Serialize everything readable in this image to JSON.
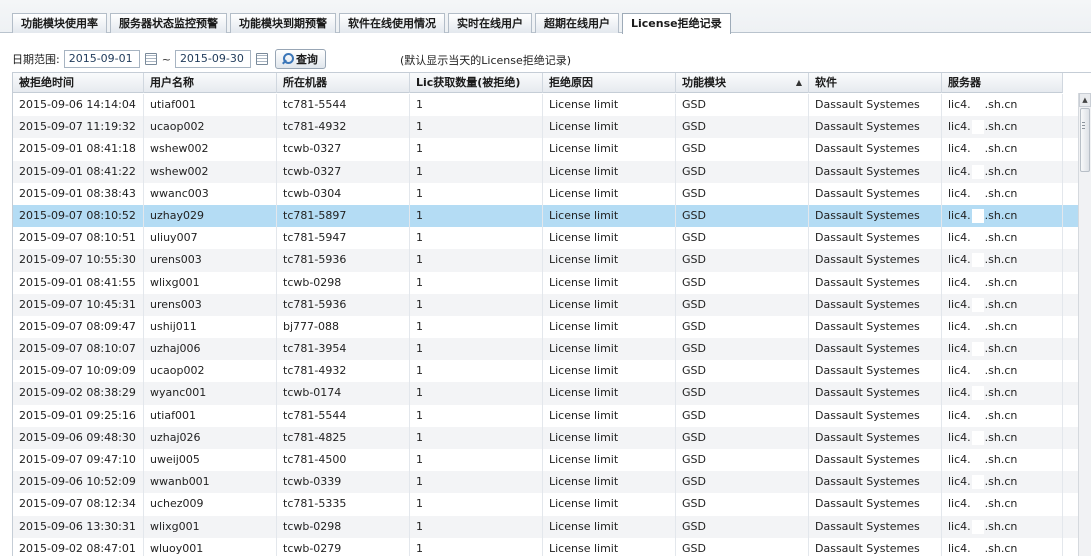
{
  "tabs": [
    {
      "label": "功能模块使用率"
    },
    {
      "label": "服务器状态监控预警"
    },
    {
      "label": "功能模块到期预警"
    },
    {
      "label": "软件在线使用情况"
    },
    {
      "label": "实时在线用户"
    },
    {
      "label": "超期在线用户"
    },
    {
      "label": "License拒绝记录",
      "active": true
    }
  ],
  "filter": {
    "date_label": "日期范围:",
    "start_date": "2015-09-01",
    "separator": "~",
    "end_date": "2015-09-30",
    "query_label": "查询",
    "note": "(默认显示当天的License拒绝记录)"
  },
  "table": {
    "columns": [
      "被拒绝时间",
      "用户名称",
      "所在机器",
      "Lic获取数量(被拒绝)",
      "拒绝原因",
      "功能模块",
      "软件",
      "服务器"
    ],
    "sorted_column": 5,
    "sort_direction": "asc",
    "selected_row": 5,
    "rows": [
      [
        "2015-09-06 14:14:04",
        "utiaf001",
        "tc781-5544",
        "1",
        "License limit",
        "GSD",
        "Dassault Systemes",
        [
          "lic4.",
          ".sh.cn"
        ]
      ],
      [
        "2015-09-07 11:19:32",
        "ucaop002",
        "tc781-4932",
        "1",
        "License limit",
        "GSD",
        "Dassault Systemes",
        [
          "lic4.",
          ".sh.cn"
        ]
      ],
      [
        "2015-09-01 08:41:18",
        "wshew002",
        "tcwb-0327",
        "1",
        "License limit",
        "GSD",
        "Dassault Systemes",
        [
          "lic4.",
          ".sh.cn"
        ]
      ],
      [
        "2015-09-01 08:41:22",
        "wshew002",
        "tcwb-0327",
        "1",
        "License limit",
        "GSD",
        "Dassault Systemes",
        [
          "lic4.",
          ".sh.cn"
        ]
      ],
      [
        "2015-09-01 08:38:43",
        "wwanc003",
        "tcwb-0304",
        "1",
        "License limit",
        "GSD",
        "Dassault Systemes",
        [
          "lic4.",
          ".sh.cn"
        ]
      ],
      [
        "2015-09-07 08:10:52",
        "uzhay029",
        "tc781-5897",
        "1",
        "License limit",
        "GSD",
        "Dassault Systemes",
        [
          "lic4.",
          ".sh.cn"
        ]
      ],
      [
        "2015-09-07 08:10:51",
        "uliuy007",
        "tc781-5947",
        "1",
        "License limit",
        "GSD",
        "Dassault Systemes",
        [
          "lic4.",
          ".sh.cn"
        ]
      ],
      [
        "2015-09-07 10:55:30",
        "urens003",
        "tc781-5936",
        "1",
        "License limit",
        "GSD",
        "Dassault Systemes",
        [
          "lic4.",
          ".sh.cn"
        ]
      ],
      [
        "2015-09-01 08:41:55",
        "wlixg001",
        "tcwb-0298",
        "1",
        "License limit",
        "GSD",
        "Dassault Systemes",
        [
          "lic4.",
          ".sh.cn"
        ]
      ],
      [
        "2015-09-07 10:45:31",
        "urens003",
        "tc781-5936",
        "1",
        "License limit",
        "GSD",
        "Dassault Systemes",
        [
          "lic4.",
          ".sh.cn"
        ]
      ],
      [
        "2015-09-07 08:09:47",
        "ushij011",
        "bj777-088",
        "1",
        "License limit",
        "GSD",
        "Dassault Systemes",
        [
          "lic4.",
          ".sh.cn"
        ]
      ],
      [
        "2015-09-07 08:10:07",
        "uzhaj006",
        "tc781-3954",
        "1",
        "License limit",
        "GSD",
        "Dassault Systemes",
        [
          "lic4.",
          ".sh.cn"
        ]
      ],
      [
        "2015-09-07 10:09:09",
        "ucaop002",
        "tc781-4932",
        "1",
        "License limit",
        "GSD",
        "Dassault Systemes",
        [
          "lic4.",
          ".sh.cn"
        ]
      ],
      [
        "2015-09-02 08:38:29",
        "wyanc001",
        "tcwb-0174",
        "1",
        "License limit",
        "GSD",
        "Dassault Systemes",
        [
          "lic4.",
          ".sh.cn"
        ]
      ],
      [
        "2015-09-01 09:25:16",
        "utiaf001",
        "tc781-5544",
        "1",
        "License limit",
        "GSD",
        "Dassault Systemes",
        [
          "lic4.",
          ".sh.cn"
        ]
      ],
      [
        "2015-09-06 09:48:30",
        "uzhaj026",
        "tc781-4825",
        "1",
        "License limit",
        "GSD",
        "Dassault Systemes",
        [
          "lic4.",
          ".sh.cn"
        ]
      ],
      [
        "2015-09-07 09:47:10",
        "uweij005",
        "tc781-4500",
        "1",
        "License limit",
        "GSD",
        "Dassault Systemes",
        [
          "lic4.",
          ".sh.cn"
        ]
      ],
      [
        "2015-09-06 10:52:09",
        "wwanb001",
        "tcwb-0339",
        "1",
        "License limit",
        "GSD",
        "Dassault Systemes",
        [
          "lic4.",
          ".sh.cn"
        ]
      ],
      [
        "2015-09-07 08:12:34",
        "uchez009",
        "tc781-5335",
        "1",
        "License limit",
        "GSD",
        "Dassault Systemes",
        [
          "lic4.",
          ".sh.cn"
        ]
      ],
      [
        "2015-09-06 13:30:31",
        "wlixg001",
        "tcwb-0298",
        "1",
        "License limit",
        "GSD",
        "Dassault Systemes",
        [
          "lic4.",
          ".sh.cn"
        ]
      ],
      [
        "2015-09-02 08:47:01",
        "wluoy001",
        "tcwb-0279",
        "1",
        "License limit",
        "GSD",
        "Dassault Systemes",
        [
          "lic4.",
          ".sh.cn"
        ]
      ]
    ]
  },
  "colors": {
    "selected_row": "#b4dcf4",
    "alt_row": "#f3f4f6",
    "header_border": "#c5cdd6"
  }
}
